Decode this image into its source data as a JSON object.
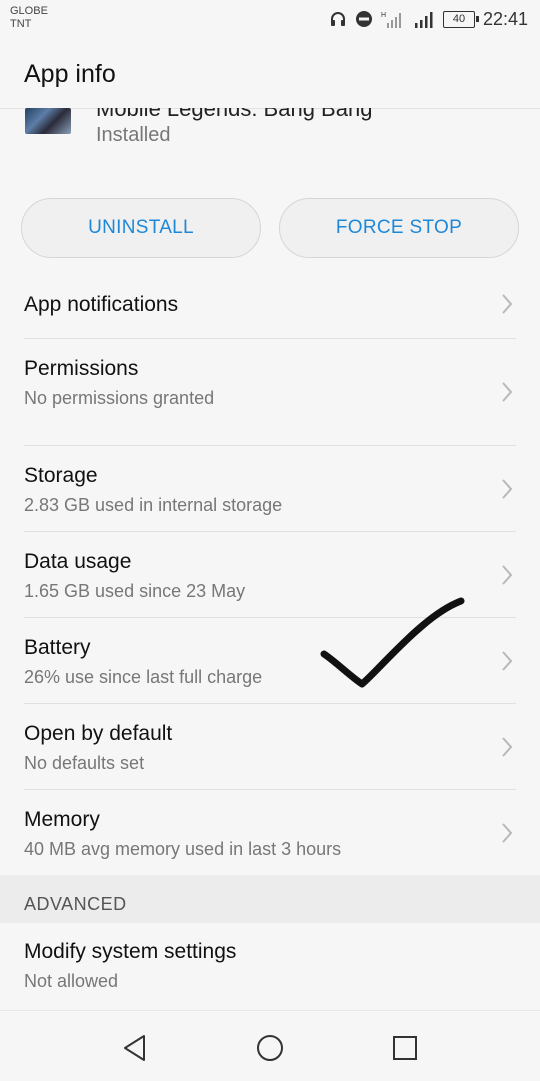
{
  "status": {
    "carrier_line1": "GLOBE",
    "carrier_line2": "TNT",
    "battery": "40",
    "time": "22:41"
  },
  "header": {
    "title": "App info"
  },
  "app": {
    "name": "Mobile Legends: Bang Bang",
    "status": "Installed"
  },
  "buttons": {
    "uninstall": "UNINSTALL",
    "force_stop": "FORCE STOP"
  },
  "items": [
    {
      "label": "App notifications",
      "sub": ""
    },
    {
      "label": "Permissions",
      "sub": "No permissions granted"
    },
    {
      "label": "Storage",
      "sub": "2.83 GB used in internal storage"
    },
    {
      "label": "Data usage",
      "sub": "1.65 GB used since 23 May"
    },
    {
      "label": "Battery",
      "sub": "26% use since last full charge"
    },
    {
      "label": "Open by default",
      "sub": "No defaults set"
    },
    {
      "label": "Memory",
      "sub": "40 MB avg memory used in last 3 hours"
    }
  ],
  "advanced": {
    "header": "ADVANCED",
    "items": [
      {
        "label": "Modify system settings",
        "sub": "Not allowed"
      }
    ]
  },
  "icons": {
    "headphones": "headphones-icon",
    "dnd": "do-not-disturb-icon",
    "signal": "signal-icon",
    "battery": "battery-icon",
    "chevron": "chevron-right-icon",
    "back": "back-triangle-icon",
    "home": "home-circle-icon",
    "recents": "recents-square-icon"
  },
  "colors": {
    "accent": "#1e88d8",
    "background": "#f6f6f6",
    "section": "#ececec"
  }
}
